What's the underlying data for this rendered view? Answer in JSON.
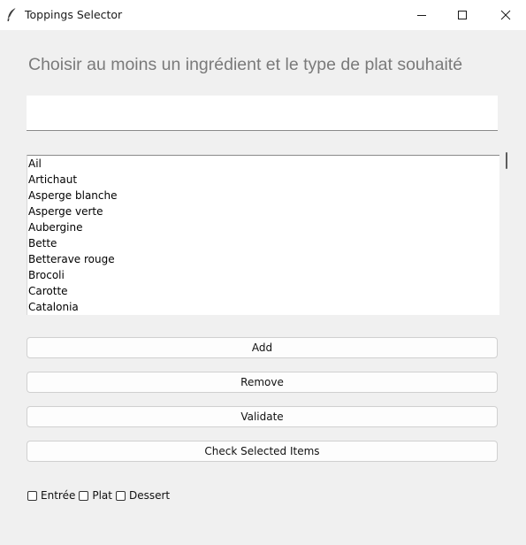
{
  "window": {
    "title": "Toppings Selector",
    "icon": "feather-icon"
  },
  "heading": "Choisir au moins un ingrédient et le type de plat souhaité",
  "search": {
    "value": "",
    "placeholder": ""
  },
  "ingredients": [
    "Ail",
    "Artichaut",
    "Asperge blanche",
    "Asperge verte",
    "Aubergine",
    "Bette",
    "Betterave rouge",
    "Brocoli",
    "Carotte",
    "Catalonia"
  ],
  "buttons": {
    "add": "Add",
    "remove": "Remove",
    "validate": "Validate",
    "check": "Check Selected Items"
  },
  "dish_types": [
    {
      "label": "Entrée",
      "checked": false
    },
    {
      "label": "Plat",
      "checked": false
    },
    {
      "label": "Dessert",
      "checked": false
    }
  ]
}
